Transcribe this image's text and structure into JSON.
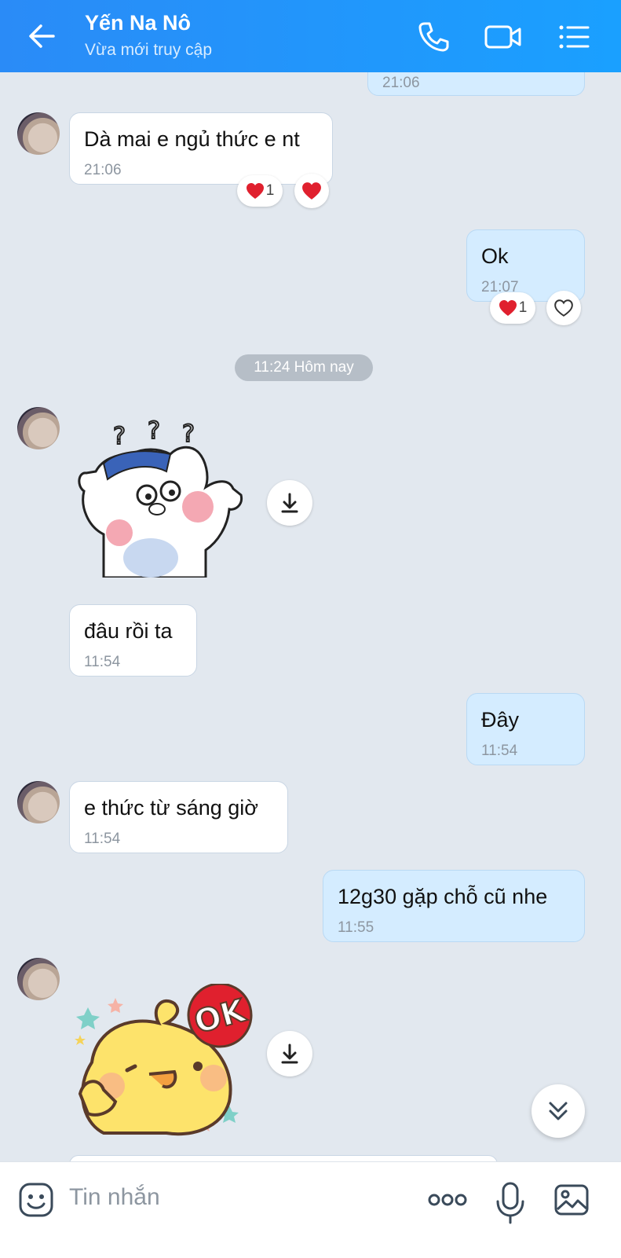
{
  "header": {
    "title": "Yến Na Nô",
    "subtitle": "Vừa mới truy cập",
    "icons": [
      "back-arrow-icon",
      "phone-icon",
      "video-call-icon",
      "menu-list-icon"
    ]
  },
  "messages": [
    {
      "from": "me",
      "text": "",
      "time": "21:06"
    },
    {
      "from": "them",
      "text": "Dà mai e ngủ thức e nt",
      "time": "21:06",
      "reaction_count": "1"
    },
    {
      "from": "me",
      "text": "Ok",
      "time": "21:07",
      "reaction_count": "1"
    },
    {
      "divider": "11:24 Hôm nay"
    },
    {
      "from": "them",
      "sticker": "cat-confused-sticker"
    },
    {
      "from": "them",
      "text": "đâu rồi ta",
      "time": "11:54"
    },
    {
      "from": "me",
      "text": "Đây",
      "time": "11:54"
    },
    {
      "from": "them",
      "text": "e thức từ sáng giờ",
      "time": "11:54"
    },
    {
      "from": "me",
      "text": "12g30 gặp chỗ cũ nhe",
      "time": "11:55"
    },
    {
      "from": "them",
      "sticker": "chick-ok-sticker",
      "sticker_text": "OK"
    }
  ],
  "input": {
    "placeholder": "Tin nhắn",
    "icons": [
      "emoji-icon",
      "more-options-icon",
      "microphone-icon",
      "image-icon"
    ]
  },
  "colors": {
    "header": "#1a9bff",
    "chat_bg": "#e2e8ef",
    "out_bubble": "#d4ecff",
    "in_bubble": "#ffffff",
    "heart": "#e0202e"
  }
}
